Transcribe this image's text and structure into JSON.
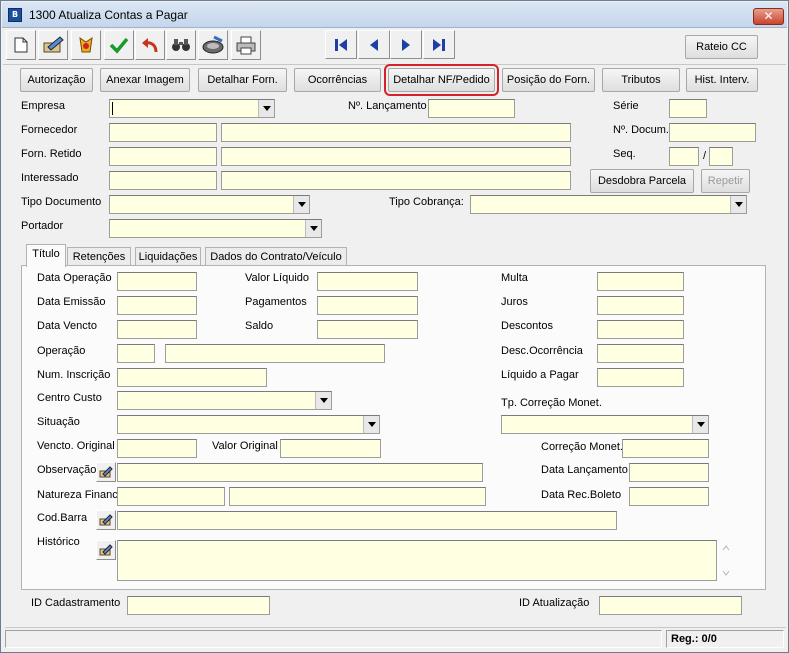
{
  "window": {
    "title": "1300 Atualiza Contas a Pagar",
    "close_symbol": "✕"
  },
  "toolbar": {
    "icons": [
      "new-document-icon",
      "edit-icon",
      "cancel-icon",
      "confirm-check-icon",
      "undo-icon",
      "find-binoculars-icon",
      "save-disk-icon",
      "print-icon"
    ],
    "nav_icons": [
      "first-record-icon",
      "previous-record-icon",
      "next-record-icon",
      "last-record-icon"
    ],
    "rateio_label": "Rateio CC"
  },
  "actions": {
    "autorizacao": "Autorização",
    "anexar_imagem": "Anexar Imagem",
    "detalhar_forn": "Detalhar Forn.",
    "ocorrencias": "Ocorrências",
    "detalhar_nf": "Detalhar NF/Pedido",
    "posicao_forn": "Posição do Forn.",
    "tributos": "Tributos",
    "hist_interv": "Hist. Interv."
  },
  "header": {
    "empresa": "Empresa",
    "n_lancamento": "Nº. Lançamento",
    "serie": "Série",
    "fornecedor": "Fornecedor",
    "n_docum": "Nº. Docum.",
    "forn_retido": "Forn. Retido",
    "seq": "Seq.",
    "seq_sep": "/",
    "interessado": "Interessado",
    "desdobra": "Desdobra Parcela",
    "repetir": "Repetir",
    "tipo_documento": "Tipo Documento",
    "tipo_cobranca": "Tipo Cobrança:",
    "portador": "Portador"
  },
  "tabs": [
    "Título",
    "Retenções",
    "Liquidações",
    "Dados do Contrato/Veículo"
  ],
  "titulo": {
    "data_operacao": "Data Operação",
    "data_emissao": "Data Emissão",
    "data_vencto": "Data Vencto",
    "operacao": "Operação",
    "num_inscricao": "Num. Inscrição",
    "centro_custo": "Centro Custo",
    "situacao": "Situação",
    "vencto_original": "Vencto. Original",
    "observacao": "Observação",
    "natureza_financ": "Natureza Financ.",
    "cod_barra": "Cod.Barra",
    "historico": "Histórico",
    "valor_liquido": "Valor Líquido",
    "pagamentos": "Pagamentos",
    "saldo": "Saldo",
    "valor_original": "Valor Original",
    "multa": "Multa",
    "juros": "Juros",
    "descontos": "Descontos",
    "desc_ocorrencia": "Desc.Ocorrência",
    "liquido_pagar": "Líquido a Pagar",
    "tp_correcao": "Tp. Correção Monet.",
    "correcao_monet": "Correção Monet.",
    "data_lancamento": "Data Lançamento",
    "data_rec_boleto": "Data Rec.Boleto"
  },
  "footer": {
    "id_cadastramento": "ID Cadastramento",
    "id_atualizacao": "ID Atualização",
    "reg": "Reg.: 0/0"
  }
}
